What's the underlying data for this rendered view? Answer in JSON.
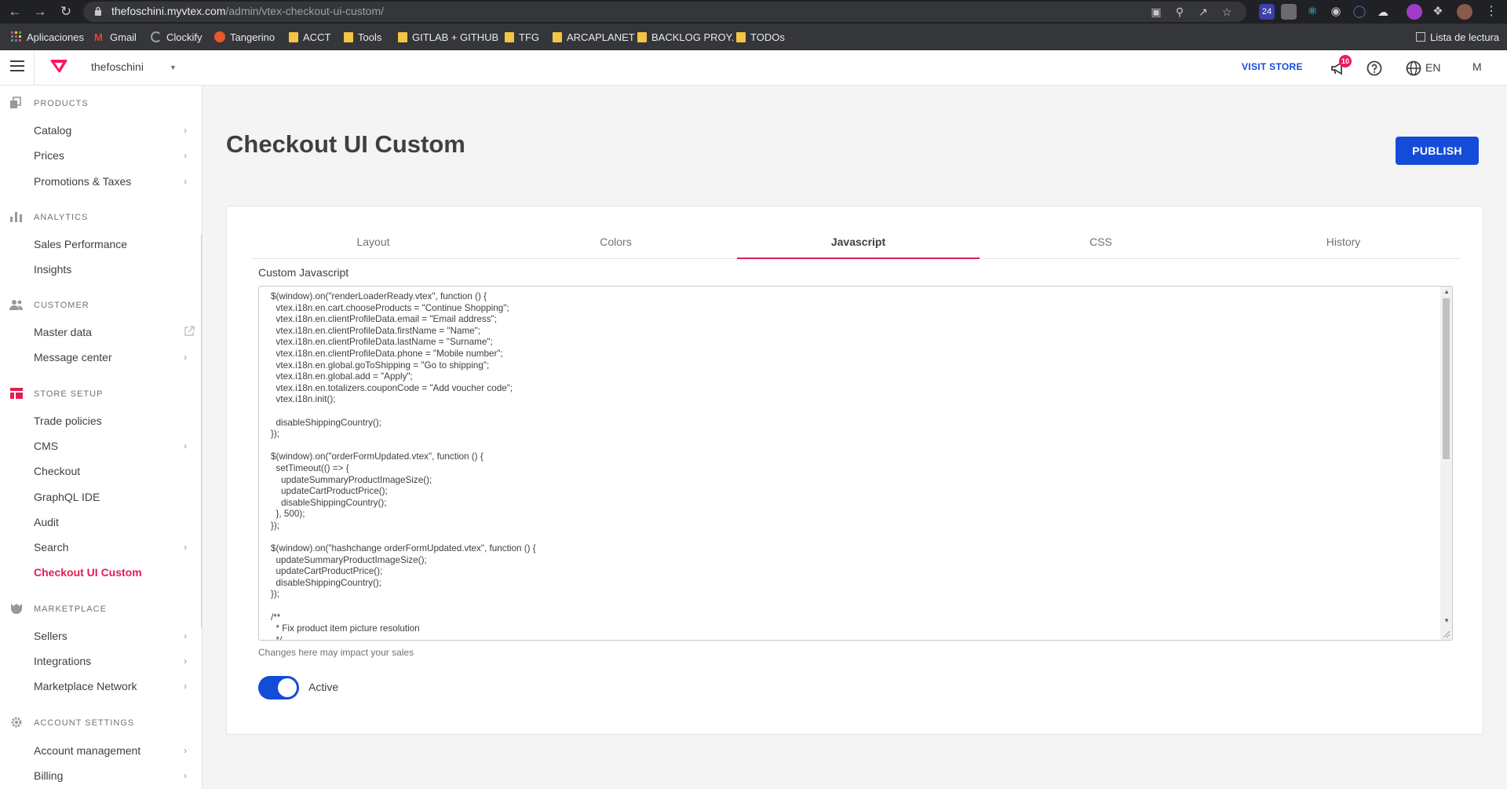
{
  "browser": {
    "url_host": "thefoschini.myvtex.com",
    "url_path": "/admin/vtex-checkout-ui-custom/",
    "extension_badge": "24",
    "bookmarks": [
      "Aplicaciones",
      "Gmail",
      "Clockify",
      "Tangerino",
      "ACCT",
      "Tools",
      "GITLAB + GITHUB",
      "TFG",
      "ARCAPLANET",
      "BACKLOG PROY.",
      "TODOs"
    ],
    "reading_list": "Lista de lectura"
  },
  "topbar": {
    "account": "thefoschini",
    "visit_store": "VISIT STORE",
    "notifications": "10",
    "language": "EN",
    "user_initial": "M"
  },
  "sidebar": {
    "sections": [
      {
        "title": "PRODUCTS",
        "icon": "products-icon",
        "items": [
          {
            "label": "Catalog",
            "chevron": true
          },
          {
            "label": "Prices",
            "chevron": true
          },
          {
            "label": "Promotions & Taxes",
            "chevron": true
          }
        ]
      },
      {
        "title": "ANALYTICS",
        "icon": "analytics-icon",
        "items": [
          {
            "label": "Sales Performance"
          },
          {
            "label": "Insights"
          }
        ]
      },
      {
        "title": "CUSTOMER",
        "icon": "customer-icon",
        "items": [
          {
            "label": "Master data",
            "external": true
          },
          {
            "label": "Message center",
            "chevron": true
          }
        ]
      },
      {
        "title": "STORE SETUP",
        "icon": "store-setup-icon",
        "items": [
          {
            "label": "Trade policies"
          },
          {
            "label": "CMS",
            "chevron": true
          },
          {
            "label": "Checkout"
          },
          {
            "label": "GraphQL IDE"
          },
          {
            "label": "Audit"
          },
          {
            "label": "Search",
            "chevron": true
          },
          {
            "label": "Checkout UI Custom",
            "active": true
          }
        ]
      },
      {
        "title": "MARKETPLACE",
        "icon": "marketplace-icon",
        "items": [
          {
            "label": "Sellers",
            "chevron": true
          },
          {
            "label": "Integrations",
            "chevron": true
          },
          {
            "label": "Marketplace Network",
            "chevron": true
          }
        ]
      },
      {
        "title": "ACCOUNT SETTINGS",
        "icon": "settings-icon",
        "items": [
          {
            "label": "Account management",
            "chevron": true
          },
          {
            "label": "Billing",
            "chevron": true
          }
        ]
      }
    ]
  },
  "main": {
    "title": "Checkout UI Custom",
    "publish_label": "PUBLISH",
    "tabs": [
      {
        "label": "Layout"
      },
      {
        "label": "Colors"
      },
      {
        "label": "Javascript",
        "active": true
      },
      {
        "label": "CSS"
      },
      {
        "label": "History"
      }
    ],
    "code_label": "Custom Javascript",
    "code": "$(window).on(\"renderLoaderReady.vtex\", function () {\n  vtex.i18n.en.cart.chooseProducts = \"Continue Shopping\";\n  vtex.i18n.en.clientProfileData.email = \"Email address\";\n  vtex.i18n.en.clientProfileData.firstName = \"Name\";\n  vtex.i18n.en.clientProfileData.lastName = \"Surname\";\n  vtex.i18n.en.clientProfileData.phone = \"Mobile number\";\n  vtex.i18n.en.global.goToShipping = \"Go to shipping\";\n  vtex.i18n.en.global.add = \"Apply\";\n  vtex.i18n.en.totalizers.couponCode = \"Add voucher code\";\n  vtex.i18n.init();\n\n  disableShippingCountry();\n});\n\n$(window).on(\"orderFormUpdated.vtex\", function () {\n  setTimeout(() => {\n    updateSummaryProductImageSize();\n    updateCartProductPrice();\n    disableShippingCountry();\n  }, 500);\n});\n\n$(window).on(\"hashchange orderFormUpdated.vtex\", function () {\n  updateSummaryProductImageSize();\n  updateCartProductPrice();\n  disableShippingCountry();\n});\n\n/**\n  * Fix product item picture resolution\n  */",
    "helper_text": "Changes here may impact your sales",
    "toggle_label": "Active",
    "toggle_on": true
  },
  "colors": {
    "primary": "#134cd8",
    "accent": "#e11e54"
  }
}
